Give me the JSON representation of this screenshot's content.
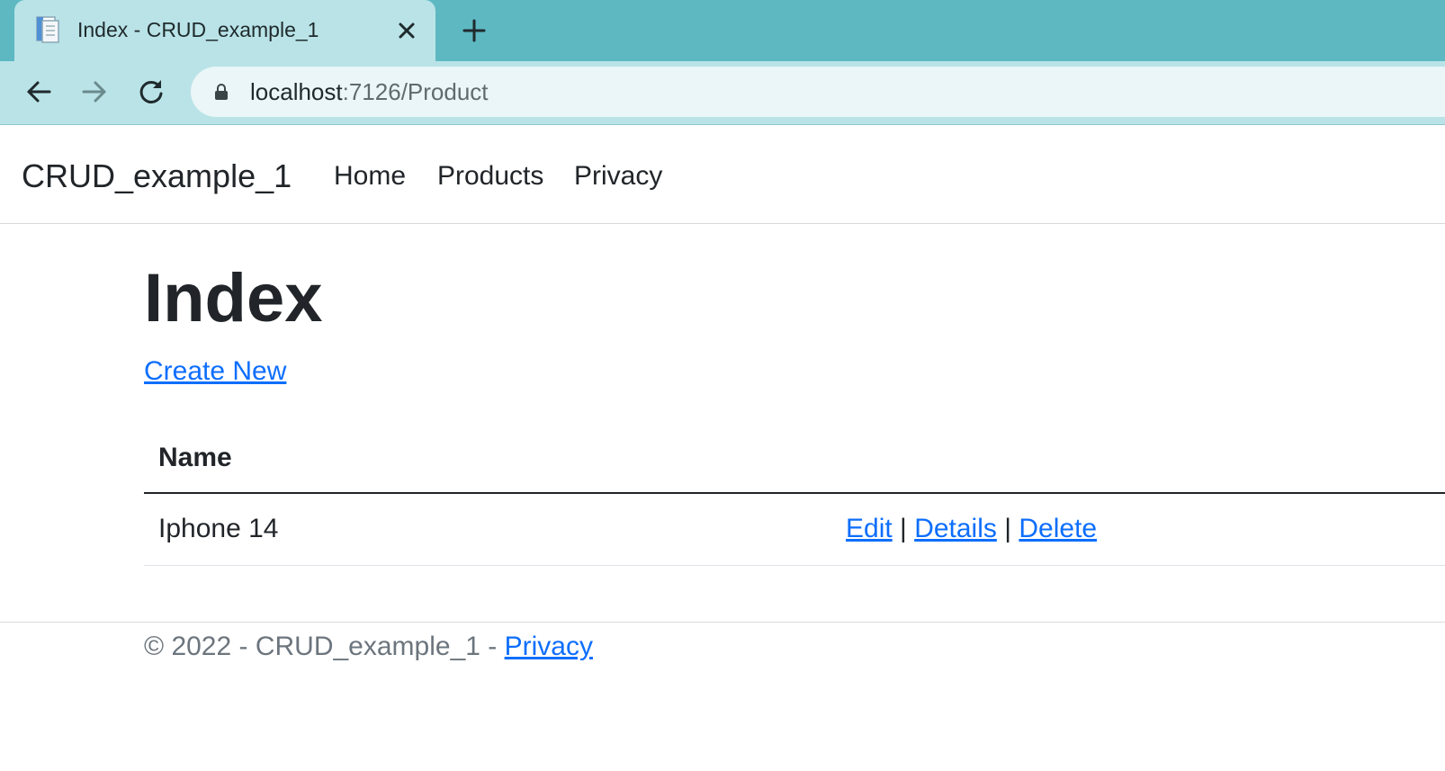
{
  "browser": {
    "tab_title": "Index - CRUD_example_1",
    "url_host": "localhost",
    "url_path": ":7126/Product",
    "theme": {
      "tabstrip": "#5db8c2",
      "toolbar": "#b9e3e7"
    }
  },
  "navbar": {
    "brand": "CRUD_example_1",
    "links": [
      "Home",
      "Products",
      "Privacy"
    ]
  },
  "main": {
    "title": "Index",
    "create_link": "Create New",
    "table": {
      "header_name": "Name",
      "rows": [
        {
          "name": "Iphone 14",
          "actions": [
            "Edit",
            "Details",
            "Delete"
          ],
          "separator": "|"
        }
      ]
    }
  },
  "footer": {
    "text": "© 2022 - CRUD_example_1 - ",
    "link": "Privacy"
  },
  "colors": {
    "link": "#0d6efd",
    "text": "#212529",
    "muted": "#6c757d"
  }
}
